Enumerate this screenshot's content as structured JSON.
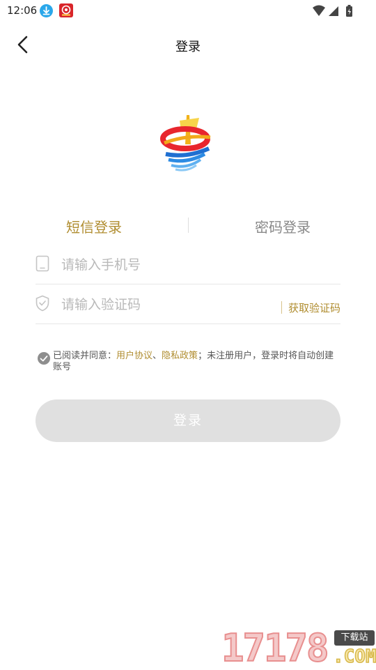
{
  "status_bar": {
    "time": "12:06"
  },
  "header": {
    "title": "登录"
  },
  "tabs": [
    {
      "label": "短信登录",
      "active": true
    },
    {
      "label": "密码登录",
      "active": false
    }
  ],
  "form": {
    "phone_placeholder": "请输入手机号",
    "code_placeholder": "请输入验证码",
    "get_code_label": "获取验证码"
  },
  "agreement": {
    "prefix": "已阅读并同意：",
    "user_agreement": "用户协议",
    "separator": "、",
    "privacy_policy": "隐私政策",
    "suffix": "；未注册用户，登录时将自动创建账号"
  },
  "login_button": "登录",
  "watermark": {
    "number": "17178",
    "badge": "下载站",
    "domain": ".COM"
  },
  "colors": {
    "accent": "#b08d30",
    "inactive_tab": "#888888",
    "button_disabled": "#e0e0e0"
  }
}
